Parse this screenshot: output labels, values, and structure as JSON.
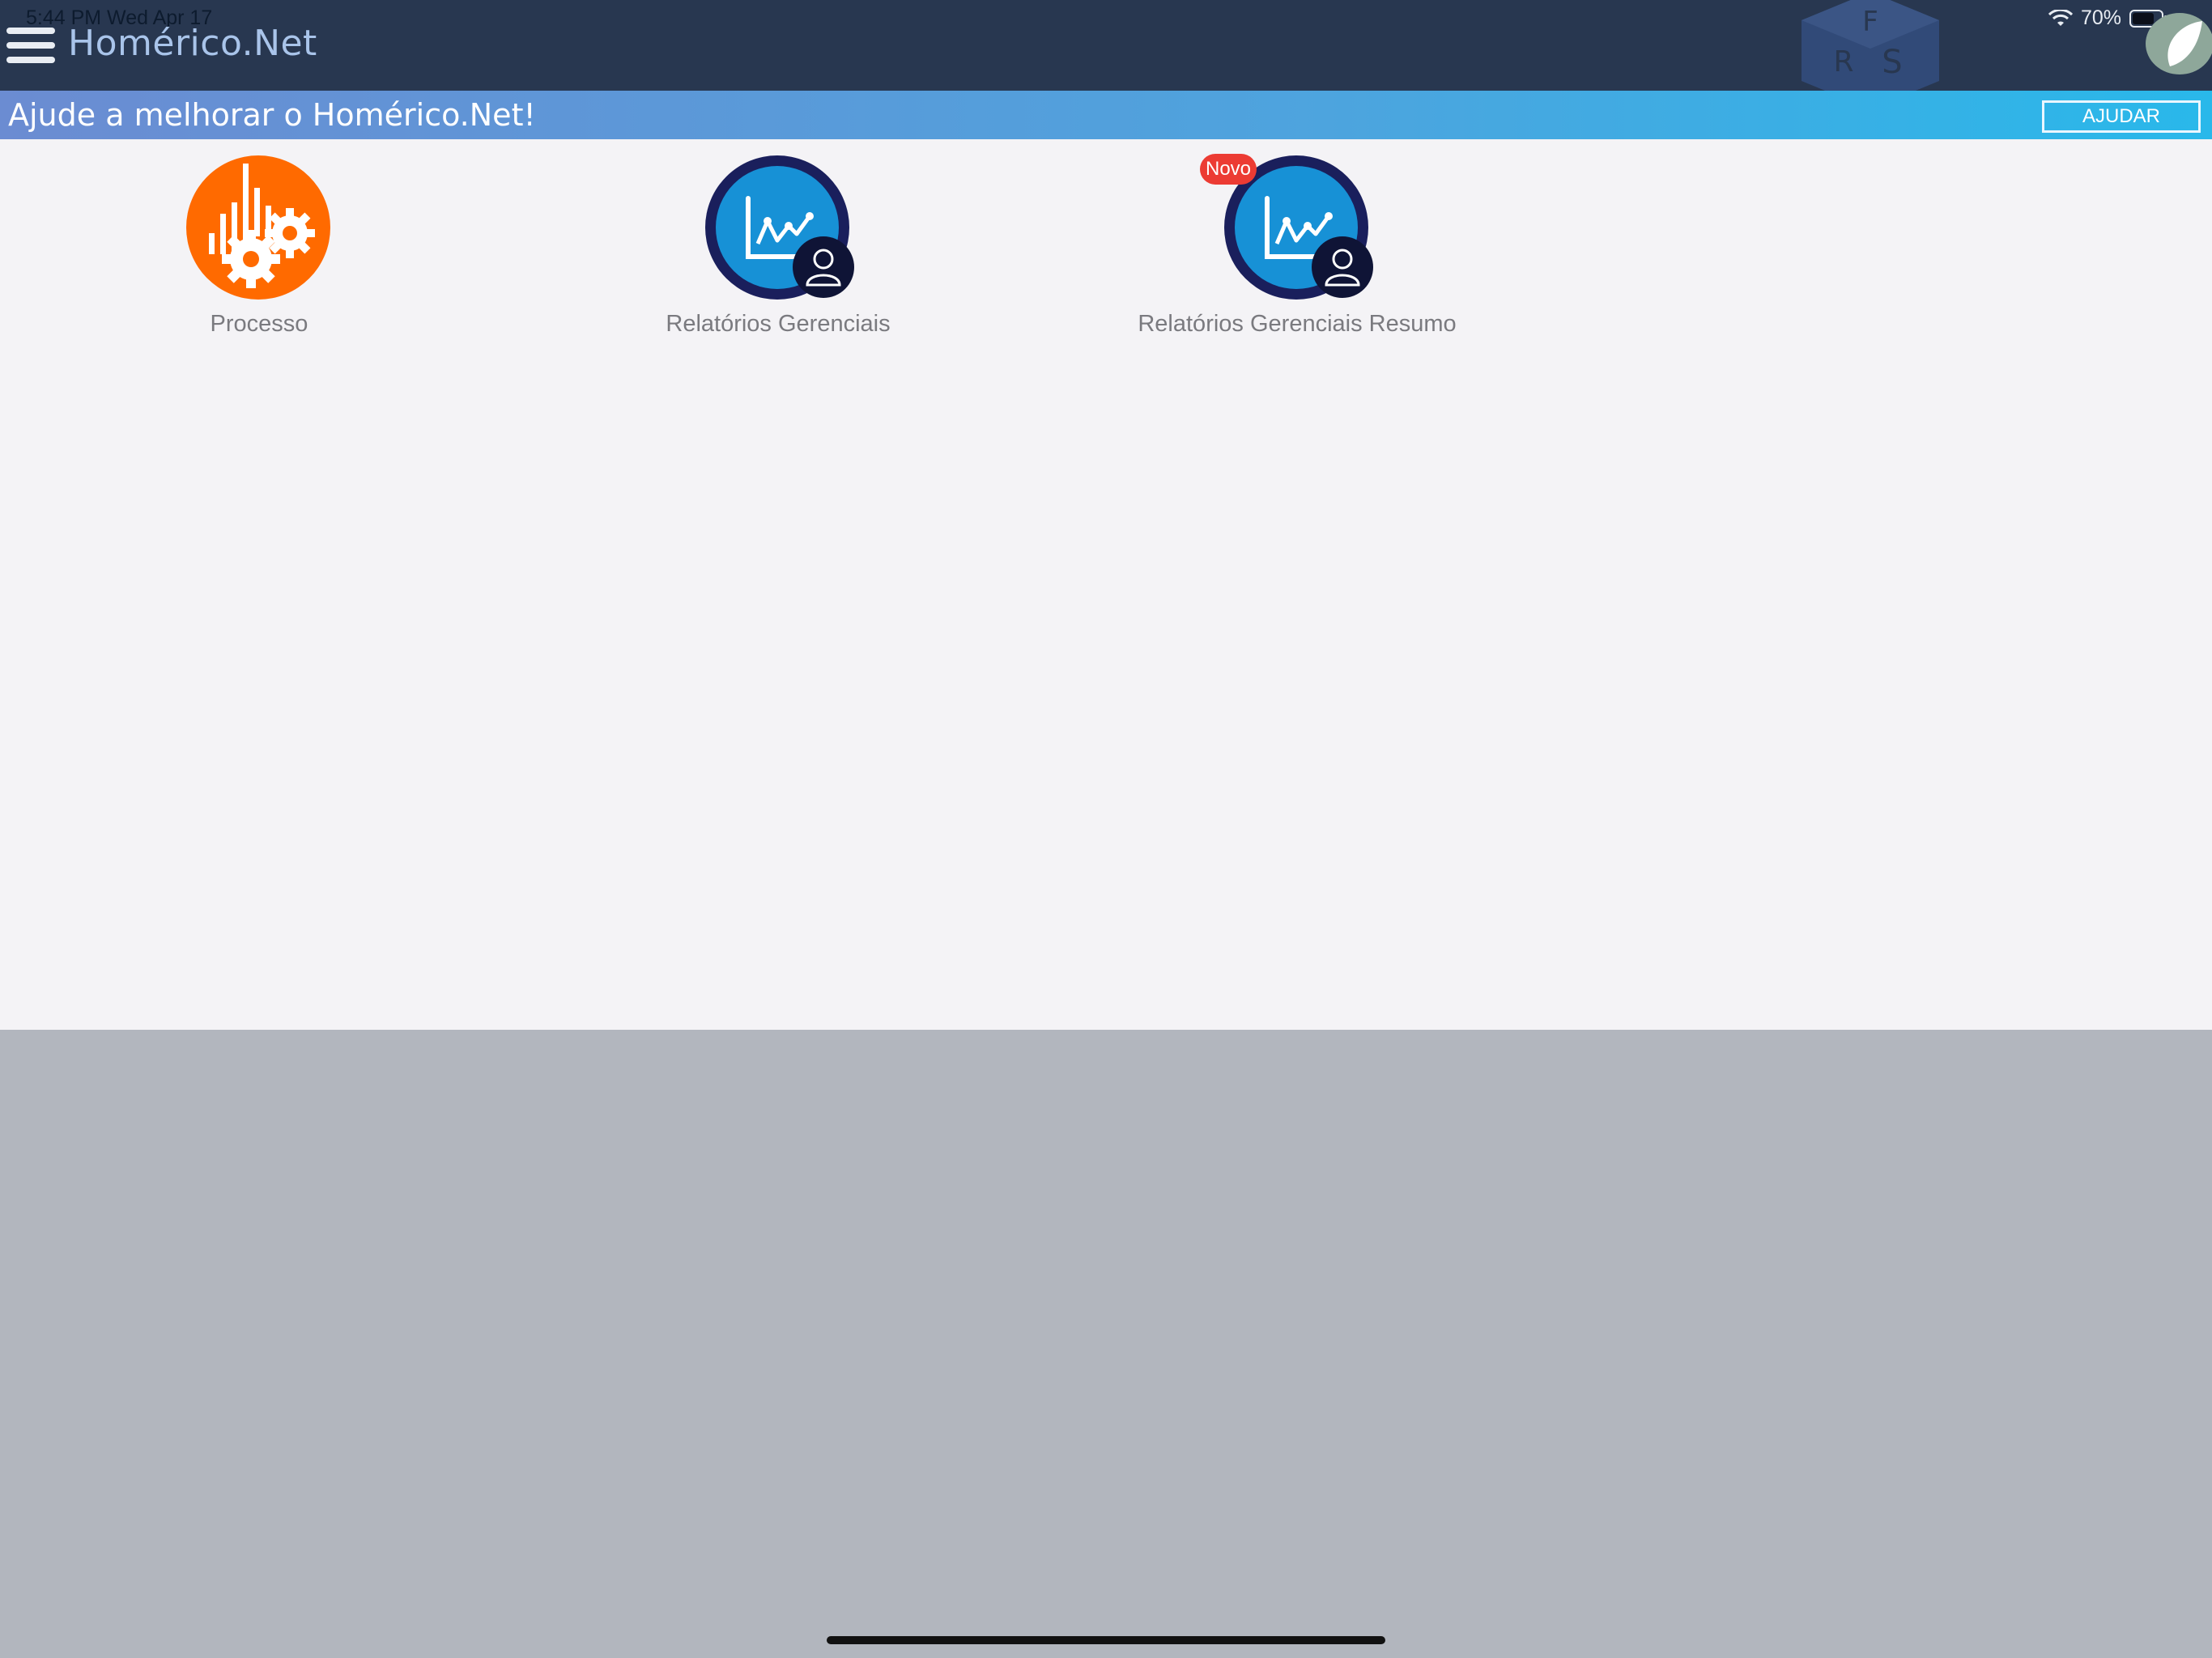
{
  "status_bar": {
    "time": "5:44 PM   Wed Apr 17",
    "battery": "70%",
    "icons": [
      "wifi-icon",
      "battery-icon"
    ]
  },
  "header": {
    "title": "Homérico.Net",
    "menu_icon": "hamburger-menu-icon",
    "logo_text": "FRS"
  },
  "banner": {
    "text": "Ajude a melhorar o Homérico.Net!",
    "button_label": "AJUDAR"
  },
  "modules": [
    {
      "label": "Processo",
      "icon": "process-gears-icon"
    },
    {
      "label": "Relatórios Gerenciais",
      "icon": "reports-chart-user-icon"
    },
    {
      "label": "Relatórios Gerenciais Resumo",
      "icon": "reports-chart-user-icon",
      "badge": "Novo"
    }
  ],
  "colors": {
    "topbar": "#283750",
    "banner_start": "#6b8cd2",
    "banner_end": "#29b8ea",
    "process_orange": "#ff6a00",
    "report_blue": "#1791d6",
    "report_ring": "#1a1f5c",
    "badge_red": "#ec3b33",
    "content_bg": "#f4f3f6",
    "bottom_bg": "#b2b6be"
  }
}
